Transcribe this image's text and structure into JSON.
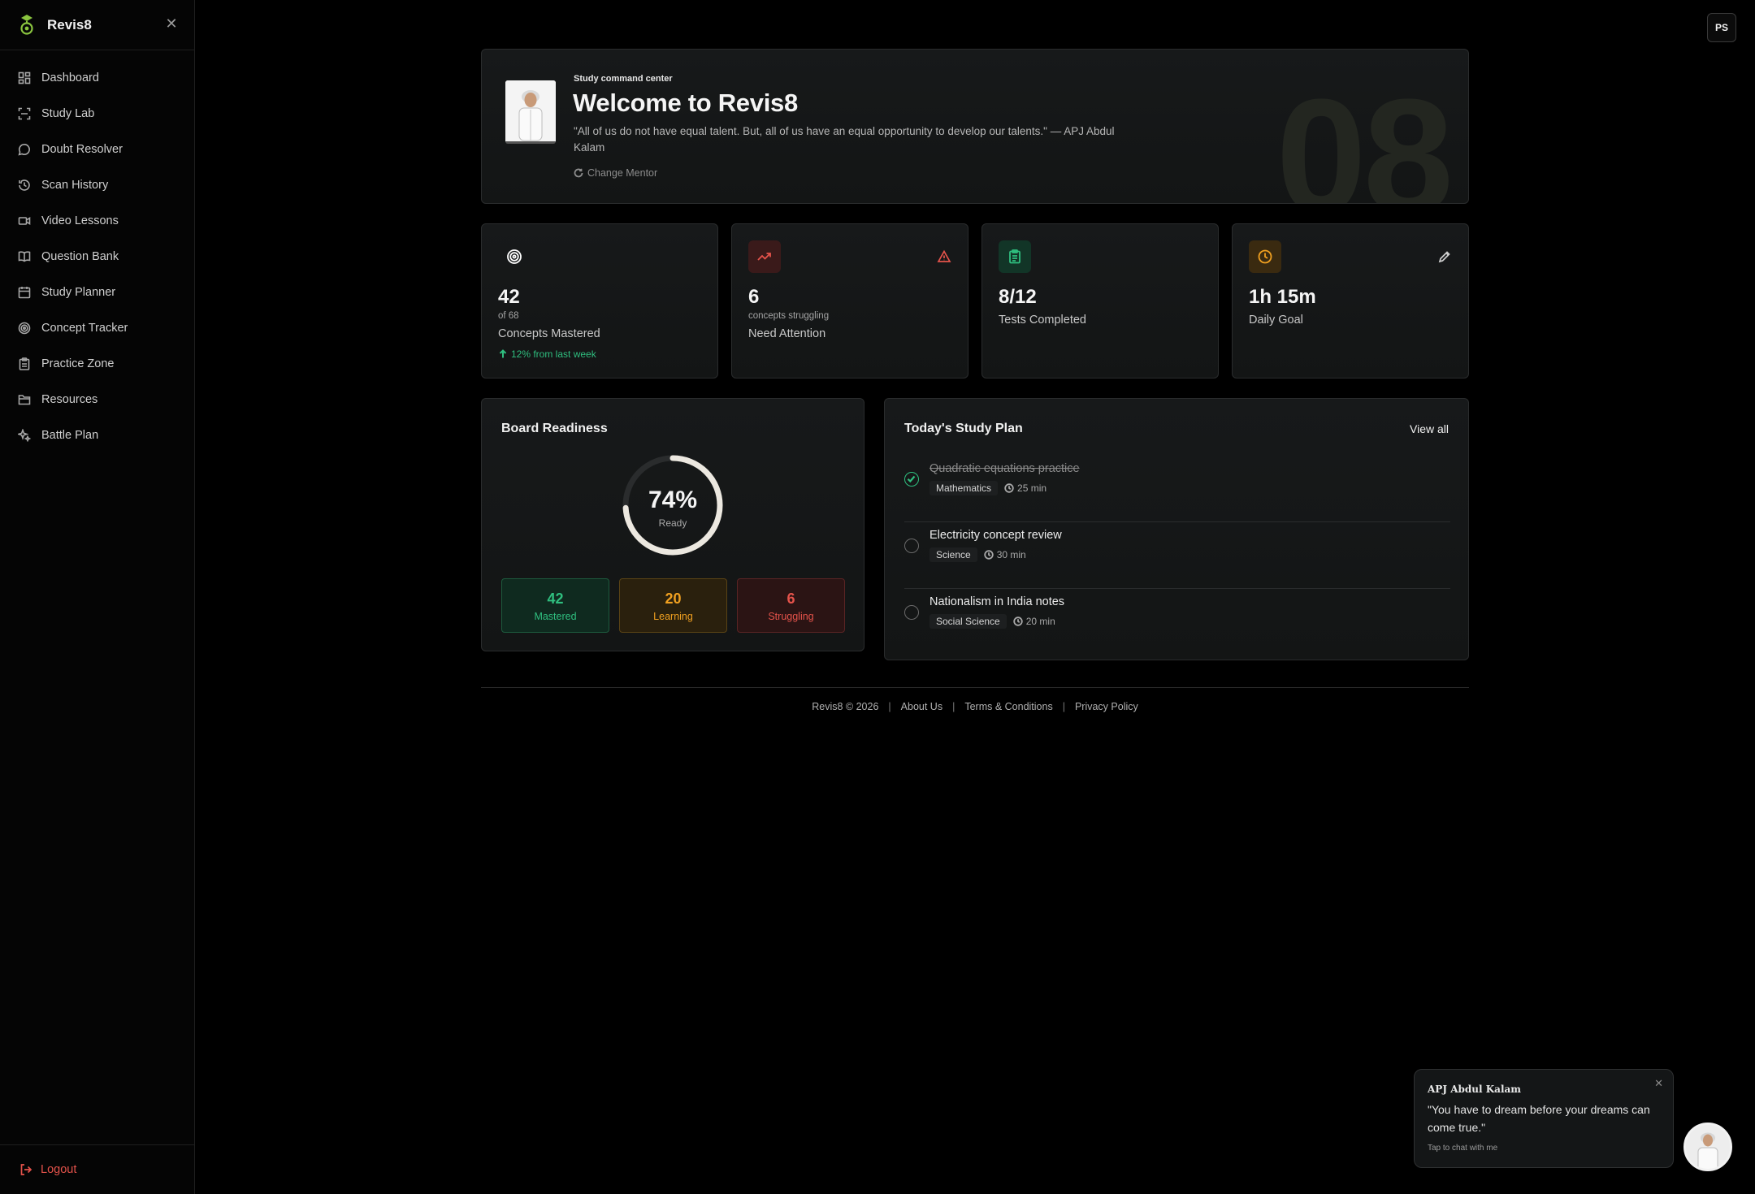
{
  "brand": {
    "name": "Revis8"
  },
  "sidebar": {
    "items": [
      {
        "label": "Dashboard",
        "icon": "grid-icon"
      },
      {
        "label": "Study Lab",
        "icon": "scan-icon"
      },
      {
        "label": "Doubt Resolver",
        "icon": "message-icon"
      },
      {
        "label": "Scan History",
        "icon": "history-icon"
      },
      {
        "label": "Video Lessons",
        "icon": "video-icon"
      },
      {
        "label": "Question Bank",
        "icon": "book-icon"
      },
      {
        "label": "Study Planner",
        "icon": "calendar-icon"
      },
      {
        "label": "Concept Tracker",
        "icon": "target-icon"
      },
      {
        "label": "Practice Zone",
        "icon": "clipboard-icon"
      },
      {
        "label": "Resources",
        "icon": "folder-icon"
      },
      {
        "label": "Battle Plan",
        "icon": "sparkle-icon"
      }
    ],
    "logout": "Logout"
  },
  "user": {
    "initials": "PS"
  },
  "hero": {
    "eyebrow": "Study command center",
    "title": "Welcome to Revis8",
    "quote": "\"All of us do not have equal talent. But, all of us have an equal opportunity to develop our talents.\" — APJ Abdul Kalam",
    "change_mentor": "Change Mentor",
    "big_number": "08"
  },
  "stats": [
    {
      "value": "42",
      "sub": "of 68",
      "label": "Concepts Mastered",
      "trend": "12% from last week",
      "icon": "target-icon",
      "accent": "#ffffff"
    },
    {
      "value": "6",
      "sub": "concepts struggling",
      "label": "Need Attention",
      "icon": "trending-up-icon",
      "accent": "#e5534b"
    },
    {
      "value": "8/12",
      "label": "Tests Completed",
      "icon": "clipboard-icon",
      "accent": "#2fbf7f"
    },
    {
      "value": "1h 15m",
      "label": "Daily Goal",
      "icon": "clock-icon",
      "accent": "#f0a020"
    }
  ],
  "board": {
    "title": "Board Readiness",
    "percent": "74%",
    "percent_value": 74,
    "status": "Ready",
    "pills": [
      {
        "value": "42",
        "label": "Mastered"
      },
      {
        "value": "20",
        "label": "Learning"
      },
      {
        "value": "6",
        "label": "Struggling"
      }
    ]
  },
  "plan": {
    "title": "Today's Study Plan",
    "view_all": "View all",
    "tasks": [
      {
        "title": "Quadratic equations practice",
        "subject": "Mathematics",
        "time": "25 min",
        "done": true
      },
      {
        "title": "Electricity concept review",
        "subject": "Science",
        "time": "30 min",
        "done": false
      },
      {
        "title": "Nationalism in India notes",
        "subject": "Social Science",
        "time": "20 min",
        "done": false
      }
    ]
  },
  "footer": {
    "copyright": "Revis8 © 2026",
    "about": "About Us",
    "terms": "Terms & Conditions",
    "privacy": "Privacy Policy"
  },
  "popup": {
    "name": "APJ Abdul Kalam",
    "quote": "\"You have to dream before your dreams can come true.\"",
    "tap": "Tap to chat with me"
  },
  "colors": {
    "success": "#2fbf7f",
    "danger": "#e5534b",
    "warning": "#f0a020"
  }
}
